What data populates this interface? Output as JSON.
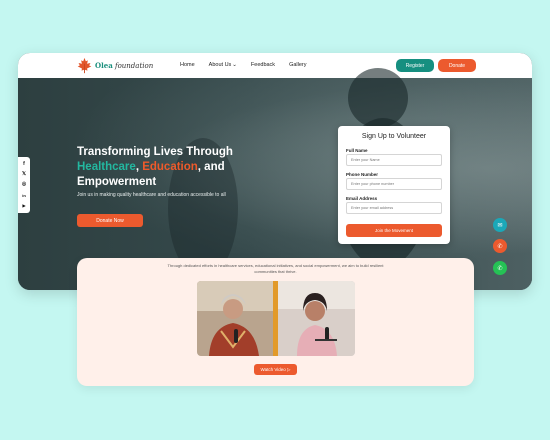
{
  "brand": {
    "name_colored": "Olea",
    "name_rest": "foundation"
  },
  "nav": {
    "links": [
      "Home",
      "About Us",
      "Feedback",
      "Gallery"
    ],
    "about_chevron": "⌄",
    "register": "Register",
    "donate": "Donate"
  },
  "social": [
    "f",
    "𝕏",
    "◎",
    "in",
    "▶"
  ],
  "hero": {
    "title_line1": "Transforming Lives Through",
    "title_healthcare": "Healthcare",
    "title_comma": ", ",
    "title_education": "Education",
    "title_and": ", and",
    "title_line3": "Empowerment",
    "subtitle": "Join us in making quality healthcare and education accessible to all",
    "donate_now": "Donate Now"
  },
  "form": {
    "title": "Sign Up to Volunteer",
    "full_name_label": "Full Name",
    "full_name_placeholder": "Enter your Name",
    "phone_label": "Phone Number",
    "phone_placeholder": "Enter your phone number",
    "email_label": "Email Address",
    "email_placeholder": "Enter your email address",
    "submit": "Join the Movement"
  },
  "float_buttons": {
    "mail": "✉",
    "phone": "✆",
    "whatsapp": "✆"
  },
  "about_card": {
    "text": "Through dedicated efforts in healthcare services, educational initiatives, and social empowerment, we aim to build resilient communities that thrive.",
    "watch_video": "Watch Video ▷"
  },
  "colors": {
    "brand_green": "#168f80",
    "brand_orange": "#ec5a2e",
    "page_bg": "#c4f7f1"
  }
}
